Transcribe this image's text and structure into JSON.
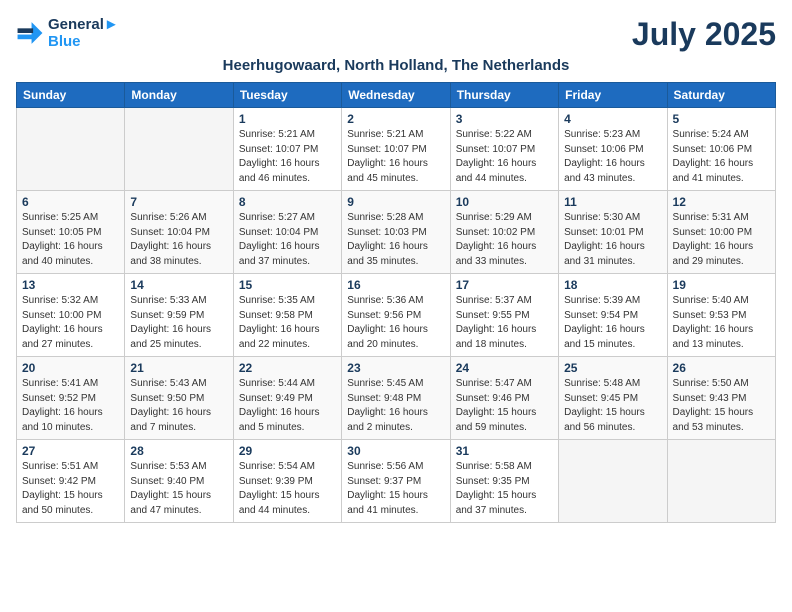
{
  "logo": {
    "line1": "General",
    "line2": "Blue"
  },
  "title": "July 2025",
  "location": "Heerhugowaard, North Holland, The Netherlands",
  "days_of_week": [
    "Sunday",
    "Monday",
    "Tuesday",
    "Wednesday",
    "Thursday",
    "Friday",
    "Saturday"
  ],
  "weeks": [
    [
      {
        "day": "",
        "info": ""
      },
      {
        "day": "",
        "info": ""
      },
      {
        "day": "1",
        "info": "Sunrise: 5:21 AM\nSunset: 10:07 PM\nDaylight: 16 hours and 46 minutes."
      },
      {
        "day": "2",
        "info": "Sunrise: 5:21 AM\nSunset: 10:07 PM\nDaylight: 16 hours and 45 minutes."
      },
      {
        "day": "3",
        "info": "Sunrise: 5:22 AM\nSunset: 10:07 PM\nDaylight: 16 hours and 44 minutes."
      },
      {
        "day": "4",
        "info": "Sunrise: 5:23 AM\nSunset: 10:06 PM\nDaylight: 16 hours and 43 minutes."
      },
      {
        "day": "5",
        "info": "Sunrise: 5:24 AM\nSunset: 10:06 PM\nDaylight: 16 hours and 41 minutes."
      }
    ],
    [
      {
        "day": "6",
        "info": "Sunrise: 5:25 AM\nSunset: 10:05 PM\nDaylight: 16 hours and 40 minutes."
      },
      {
        "day": "7",
        "info": "Sunrise: 5:26 AM\nSunset: 10:04 PM\nDaylight: 16 hours and 38 minutes."
      },
      {
        "day": "8",
        "info": "Sunrise: 5:27 AM\nSunset: 10:04 PM\nDaylight: 16 hours and 37 minutes."
      },
      {
        "day": "9",
        "info": "Sunrise: 5:28 AM\nSunset: 10:03 PM\nDaylight: 16 hours and 35 minutes."
      },
      {
        "day": "10",
        "info": "Sunrise: 5:29 AM\nSunset: 10:02 PM\nDaylight: 16 hours and 33 minutes."
      },
      {
        "day": "11",
        "info": "Sunrise: 5:30 AM\nSunset: 10:01 PM\nDaylight: 16 hours and 31 minutes."
      },
      {
        "day": "12",
        "info": "Sunrise: 5:31 AM\nSunset: 10:00 PM\nDaylight: 16 hours and 29 minutes."
      }
    ],
    [
      {
        "day": "13",
        "info": "Sunrise: 5:32 AM\nSunset: 10:00 PM\nDaylight: 16 hours and 27 minutes."
      },
      {
        "day": "14",
        "info": "Sunrise: 5:33 AM\nSunset: 9:59 PM\nDaylight: 16 hours and 25 minutes."
      },
      {
        "day": "15",
        "info": "Sunrise: 5:35 AM\nSunset: 9:58 PM\nDaylight: 16 hours and 22 minutes."
      },
      {
        "day": "16",
        "info": "Sunrise: 5:36 AM\nSunset: 9:56 PM\nDaylight: 16 hours and 20 minutes."
      },
      {
        "day": "17",
        "info": "Sunrise: 5:37 AM\nSunset: 9:55 PM\nDaylight: 16 hours and 18 minutes."
      },
      {
        "day": "18",
        "info": "Sunrise: 5:39 AM\nSunset: 9:54 PM\nDaylight: 16 hours and 15 minutes."
      },
      {
        "day": "19",
        "info": "Sunrise: 5:40 AM\nSunset: 9:53 PM\nDaylight: 16 hours and 13 minutes."
      }
    ],
    [
      {
        "day": "20",
        "info": "Sunrise: 5:41 AM\nSunset: 9:52 PM\nDaylight: 16 hours and 10 minutes."
      },
      {
        "day": "21",
        "info": "Sunrise: 5:43 AM\nSunset: 9:50 PM\nDaylight: 16 hours and 7 minutes."
      },
      {
        "day": "22",
        "info": "Sunrise: 5:44 AM\nSunset: 9:49 PM\nDaylight: 16 hours and 5 minutes."
      },
      {
        "day": "23",
        "info": "Sunrise: 5:45 AM\nSunset: 9:48 PM\nDaylight: 16 hours and 2 minutes."
      },
      {
        "day": "24",
        "info": "Sunrise: 5:47 AM\nSunset: 9:46 PM\nDaylight: 15 hours and 59 minutes."
      },
      {
        "day": "25",
        "info": "Sunrise: 5:48 AM\nSunset: 9:45 PM\nDaylight: 15 hours and 56 minutes."
      },
      {
        "day": "26",
        "info": "Sunrise: 5:50 AM\nSunset: 9:43 PM\nDaylight: 15 hours and 53 minutes."
      }
    ],
    [
      {
        "day": "27",
        "info": "Sunrise: 5:51 AM\nSunset: 9:42 PM\nDaylight: 15 hours and 50 minutes."
      },
      {
        "day": "28",
        "info": "Sunrise: 5:53 AM\nSunset: 9:40 PM\nDaylight: 15 hours and 47 minutes."
      },
      {
        "day": "29",
        "info": "Sunrise: 5:54 AM\nSunset: 9:39 PM\nDaylight: 15 hours and 44 minutes."
      },
      {
        "day": "30",
        "info": "Sunrise: 5:56 AM\nSunset: 9:37 PM\nDaylight: 15 hours and 41 minutes."
      },
      {
        "day": "31",
        "info": "Sunrise: 5:58 AM\nSunset: 9:35 PM\nDaylight: 15 hours and 37 minutes."
      },
      {
        "day": "",
        "info": ""
      },
      {
        "day": "",
        "info": ""
      }
    ]
  ]
}
